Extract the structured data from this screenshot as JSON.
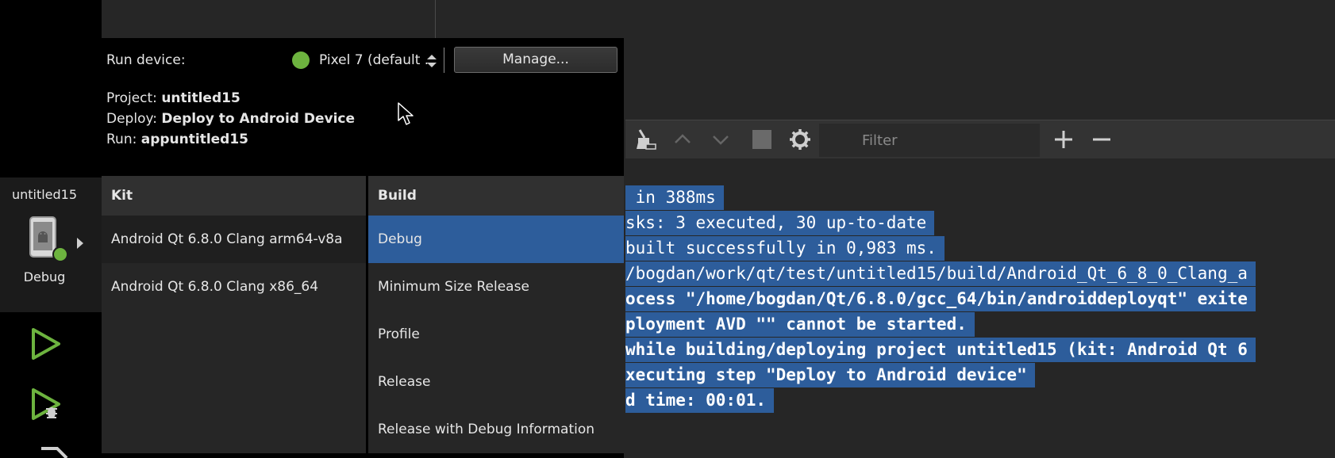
{
  "target_selector": {
    "project": "untitled15",
    "build": "Debug"
  },
  "popup": {
    "run_device_label": "Run device:",
    "device_name": "Pixel 7 (default ...",
    "manage_label": "Manage...",
    "project_label": "Project:",
    "project_value": "untitled15",
    "deploy_label": "Deploy:",
    "deploy_value": "Deploy to Android Device",
    "run_label": "Run:",
    "run_value": "appuntitled15"
  },
  "kit_column": {
    "header": "Kit",
    "items": [
      "Android Qt 6.8.0 Clang arm64-v8a",
      "Android Qt 6.8.0 Clang x86_64"
    ]
  },
  "build_column": {
    "header": "Build",
    "items": [
      "Debug",
      "Minimum Size Release",
      "Profile",
      "Release",
      "Release with Debug Information"
    ]
  },
  "output_toolbar": {
    "filter_placeholder": "Filter"
  },
  "output_lines": [
    " in 388ms",
    "sks: 3 executed, 30 up-to-date",
    "built successfully in 0,983 ms.",
    "/bogdan/work/qt/test/untitled15/build/Android_Qt_6_8_0_Clang_a",
    "ocess \"/home/bogdan/Qt/6.8.0/gcc_64/bin/androiddeployqt\" exite",
    "ployment AVD \"\" cannot be started.",
    "while building/deploying project untitled15 (kit: Android Qt 6",
    "xecuting step \"Deploy to Android device\"",
    "d time: 00:01."
  ],
  "colors": {
    "accent_green": "#6db33f",
    "selection_blue": "#2d5d9b"
  }
}
